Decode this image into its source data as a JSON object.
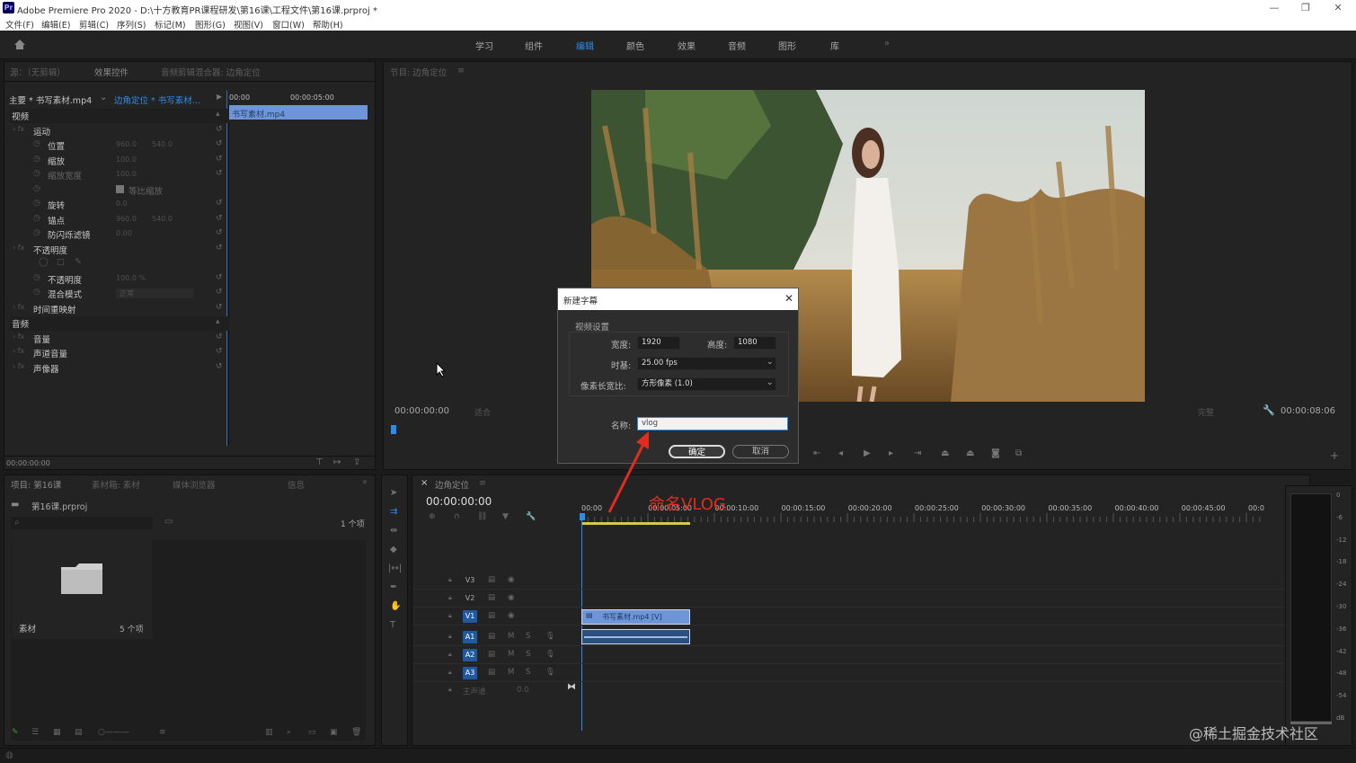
{
  "window": {
    "logo": "Pr",
    "title": "Adobe Premiere Pro 2020 - D:\\十方教育PR课程研发\\第16课\\工程文件\\第16课.prproj *",
    "minimize": "—",
    "maximize": "❐",
    "close": "✕"
  },
  "menu": [
    "文件(F)",
    "编辑(E)",
    "剪辑(C)",
    "序列(S)",
    "标记(M)",
    "图形(G)",
    "视图(V)",
    "窗口(W)",
    "帮助(H)"
  ],
  "workspaces": [
    "学习",
    "组件",
    "编辑",
    "颜色",
    "效果",
    "音频",
    "图形",
    "库"
  ],
  "workspace_more": "»",
  "source_panel": {
    "tabs": [
      "源：（无剪辑）",
      "效果控件",
      "音频剪辑混合器: 边角定位"
    ],
    "master": "主要 * 书写素材.mp4",
    "clip": "边角定位 * 书写素材...",
    "t0": "00:00",
    "t1": "00:00:05:00",
    "clip_bar": "书写素材.mp4",
    "timecode": "00:00:00:00",
    "rows": [
      {
        "label": "视频",
        "kind": "section"
      },
      {
        "label": "运动",
        "kind": "fx"
      },
      {
        "label": "位置",
        "kind": "prop",
        "v1": "960.0",
        "v2": "540.0"
      },
      {
        "label": "缩放",
        "kind": "prop",
        "v1": "100.0"
      },
      {
        "label": "缩放宽度",
        "kind": "propdim",
        "v1": "100.0"
      },
      {
        "label": "等比缩放",
        "kind": "check"
      },
      {
        "label": "旋转",
        "kind": "prop",
        "v1": "0.0"
      },
      {
        "label": "锚点",
        "kind": "prop",
        "v1": "960.0",
        "v2": "540.0"
      },
      {
        "label": "防闪烁滤镜",
        "kind": "prop",
        "v1": "0.00"
      },
      {
        "label": "不透明度",
        "kind": "fx"
      },
      {
        "label": "",
        "kind": "masks"
      },
      {
        "label": "不透明度",
        "kind": "prop",
        "v1": "100.0 %"
      },
      {
        "label": "混合模式",
        "kind": "select",
        "v1": "正常"
      },
      {
        "label": "时间重映射",
        "kind": "fx"
      },
      {
        "label": "音频",
        "kind": "section"
      },
      {
        "label": "音量",
        "kind": "fx"
      },
      {
        "label": "声道音量",
        "kind": "fx"
      },
      {
        "label": "声像器",
        "kind": "fx"
      }
    ]
  },
  "program": {
    "tab": "节目: 边角定位",
    "timecode_left": "00:00:00:00",
    "fit": "适合",
    "full": "完整",
    "timecode_right": "00:00:08:06"
  },
  "project": {
    "tabs": [
      "项目: 第16课",
      "素材箱: 素材",
      "媒体浏览器",
      "信息"
    ],
    "file": "第16课.prproj",
    "count": "1 个项",
    "bin_name": "素材",
    "bin_count": "5 个项"
  },
  "timeline": {
    "tab": "边角定位",
    "timecode": "00:00:00:00",
    "ruler": [
      "00:00",
      "00:00:05:00",
      "00:00:10:00",
      "00:00:15:00",
      "00:00:20:00",
      "00:00:25:00",
      "00:00:30:00",
      "00:00:35:00",
      "00:00:40:00",
      "00:00:45:00",
      "00:00:50:"
    ],
    "video_tracks": [
      "V3",
      "V2",
      "V1"
    ],
    "audio_tracks": [
      "A1",
      "A2",
      "A3"
    ],
    "master": "主声道",
    "master_val": "0.0",
    "clip_v": "书写素材.mp4 [V]",
    "meter": [
      "0",
      "-6",
      "-12",
      "-18",
      "-24",
      "-30",
      "-36",
      "-42",
      "-48",
      "-54",
      "dB"
    ]
  },
  "dialog": {
    "title": "新建字幕",
    "section": "视频设置",
    "width_label": "宽度:",
    "width": "1920",
    "height_label": "高度:",
    "height": "1080",
    "timebase_label": "时基:",
    "timebase": "25.00 fps",
    "par_label": "像素长宽比:",
    "par": "方形像素 (1.0)",
    "name_label": "名称:",
    "name": "vlog",
    "ok": "确定",
    "cancel": "取消"
  },
  "annotation": "命名VLOG",
  "watermark": "@稀土掘金技术社区",
  "colors": {
    "accent": "#2d8ceb",
    "annotation": "#e02d1f",
    "clip_video": "#6d95d8",
    "clip_audio": "#2b4f7e"
  }
}
